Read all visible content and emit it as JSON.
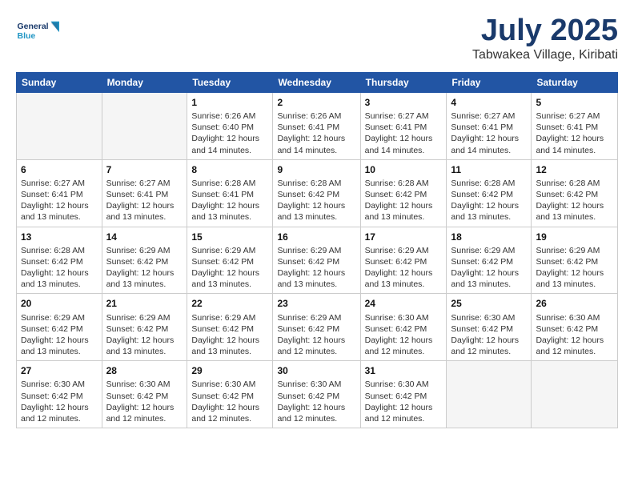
{
  "header": {
    "logo_line1": "General",
    "logo_line2": "Blue",
    "month": "July 2025",
    "location": "Tabwakea Village, Kiribati"
  },
  "weekdays": [
    "Sunday",
    "Monday",
    "Tuesday",
    "Wednesday",
    "Thursday",
    "Friday",
    "Saturday"
  ],
  "weeks": [
    [
      {
        "day": "",
        "detail": ""
      },
      {
        "day": "",
        "detail": ""
      },
      {
        "day": "1",
        "detail": "Sunrise: 6:26 AM\nSunset: 6:40 PM\nDaylight: 12 hours and 14 minutes."
      },
      {
        "day": "2",
        "detail": "Sunrise: 6:26 AM\nSunset: 6:41 PM\nDaylight: 12 hours and 14 minutes."
      },
      {
        "day": "3",
        "detail": "Sunrise: 6:27 AM\nSunset: 6:41 PM\nDaylight: 12 hours and 14 minutes."
      },
      {
        "day": "4",
        "detail": "Sunrise: 6:27 AM\nSunset: 6:41 PM\nDaylight: 12 hours and 14 minutes."
      },
      {
        "day": "5",
        "detail": "Sunrise: 6:27 AM\nSunset: 6:41 PM\nDaylight: 12 hours and 14 minutes."
      }
    ],
    [
      {
        "day": "6",
        "detail": "Sunrise: 6:27 AM\nSunset: 6:41 PM\nDaylight: 12 hours and 13 minutes."
      },
      {
        "day": "7",
        "detail": "Sunrise: 6:27 AM\nSunset: 6:41 PM\nDaylight: 12 hours and 13 minutes."
      },
      {
        "day": "8",
        "detail": "Sunrise: 6:28 AM\nSunset: 6:41 PM\nDaylight: 12 hours and 13 minutes."
      },
      {
        "day": "9",
        "detail": "Sunrise: 6:28 AM\nSunset: 6:42 PM\nDaylight: 12 hours and 13 minutes."
      },
      {
        "day": "10",
        "detail": "Sunrise: 6:28 AM\nSunset: 6:42 PM\nDaylight: 12 hours and 13 minutes."
      },
      {
        "day": "11",
        "detail": "Sunrise: 6:28 AM\nSunset: 6:42 PM\nDaylight: 12 hours and 13 minutes."
      },
      {
        "day": "12",
        "detail": "Sunrise: 6:28 AM\nSunset: 6:42 PM\nDaylight: 12 hours and 13 minutes."
      }
    ],
    [
      {
        "day": "13",
        "detail": "Sunrise: 6:28 AM\nSunset: 6:42 PM\nDaylight: 12 hours and 13 minutes."
      },
      {
        "day": "14",
        "detail": "Sunrise: 6:29 AM\nSunset: 6:42 PM\nDaylight: 12 hours and 13 minutes."
      },
      {
        "day": "15",
        "detail": "Sunrise: 6:29 AM\nSunset: 6:42 PM\nDaylight: 12 hours and 13 minutes."
      },
      {
        "day": "16",
        "detail": "Sunrise: 6:29 AM\nSunset: 6:42 PM\nDaylight: 12 hours and 13 minutes."
      },
      {
        "day": "17",
        "detail": "Sunrise: 6:29 AM\nSunset: 6:42 PM\nDaylight: 12 hours and 13 minutes."
      },
      {
        "day": "18",
        "detail": "Sunrise: 6:29 AM\nSunset: 6:42 PM\nDaylight: 12 hours and 13 minutes."
      },
      {
        "day": "19",
        "detail": "Sunrise: 6:29 AM\nSunset: 6:42 PM\nDaylight: 12 hours and 13 minutes."
      }
    ],
    [
      {
        "day": "20",
        "detail": "Sunrise: 6:29 AM\nSunset: 6:42 PM\nDaylight: 12 hours and 13 minutes."
      },
      {
        "day": "21",
        "detail": "Sunrise: 6:29 AM\nSunset: 6:42 PM\nDaylight: 12 hours and 13 minutes."
      },
      {
        "day": "22",
        "detail": "Sunrise: 6:29 AM\nSunset: 6:42 PM\nDaylight: 12 hours and 13 minutes."
      },
      {
        "day": "23",
        "detail": "Sunrise: 6:29 AM\nSunset: 6:42 PM\nDaylight: 12 hours and 12 minutes."
      },
      {
        "day": "24",
        "detail": "Sunrise: 6:30 AM\nSunset: 6:42 PM\nDaylight: 12 hours and 12 minutes."
      },
      {
        "day": "25",
        "detail": "Sunrise: 6:30 AM\nSunset: 6:42 PM\nDaylight: 12 hours and 12 minutes."
      },
      {
        "day": "26",
        "detail": "Sunrise: 6:30 AM\nSunset: 6:42 PM\nDaylight: 12 hours and 12 minutes."
      }
    ],
    [
      {
        "day": "27",
        "detail": "Sunrise: 6:30 AM\nSunset: 6:42 PM\nDaylight: 12 hours and 12 minutes."
      },
      {
        "day": "28",
        "detail": "Sunrise: 6:30 AM\nSunset: 6:42 PM\nDaylight: 12 hours and 12 minutes."
      },
      {
        "day": "29",
        "detail": "Sunrise: 6:30 AM\nSunset: 6:42 PM\nDaylight: 12 hours and 12 minutes."
      },
      {
        "day": "30",
        "detail": "Sunrise: 6:30 AM\nSunset: 6:42 PM\nDaylight: 12 hours and 12 minutes."
      },
      {
        "day": "31",
        "detail": "Sunrise: 6:30 AM\nSunset: 6:42 PM\nDaylight: 12 hours and 12 minutes."
      },
      {
        "day": "",
        "detail": ""
      },
      {
        "day": "",
        "detail": ""
      }
    ]
  ]
}
